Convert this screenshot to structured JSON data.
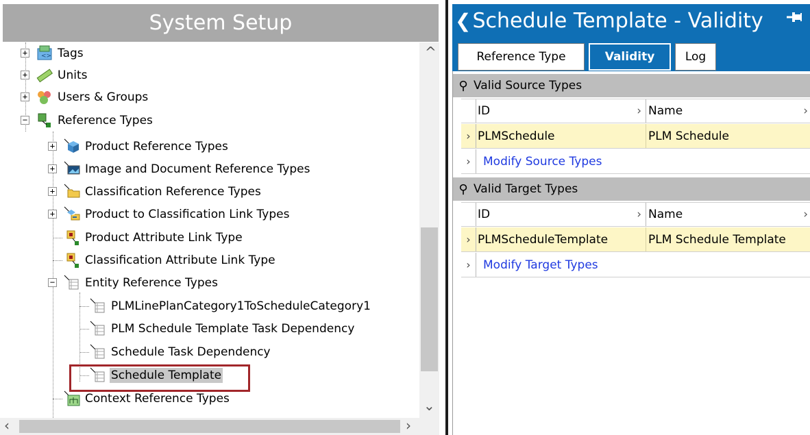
{
  "left_panel": {
    "title": "System Setup",
    "tree": [
      {
        "label": "Tags",
        "icon": "tags-icon"
      },
      {
        "label": "Units",
        "icon": "ruler-icon"
      },
      {
        "label": "Users & Groups",
        "icon": "users-groups-icon"
      },
      {
        "label": "Reference Types",
        "icon": "reference-types-icon"
      },
      {
        "label": "Product Reference Types",
        "icon": "product-ref-icon"
      },
      {
        "label": "Image and Document Reference Types",
        "icon": "image-doc-ref-icon"
      },
      {
        "label": "Classification Reference Types",
        "icon": "folder-icon"
      },
      {
        "label": "Product to Classification Link Types",
        "icon": "product-class-link-icon"
      },
      {
        "label": "Product Attribute Link Type",
        "icon": "attribute-link-icon"
      },
      {
        "label": "Classification Attribute Link Type",
        "icon": "attribute-link-icon"
      },
      {
        "label": "Entity Reference Types",
        "icon": "entity-ref-icon"
      },
      {
        "label": "PLMLinePlanCategory1ToScheduleCategory1",
        "icon": "entity-icon"
      },
      {
        "label": "PLM Schedule Template Task Dependency",
        "icon": "entity-icon"
      },
      {
        "label": "Schedule Task Dependency",
        "icon": "entity-icon"
      },
      {
        "label": "Schedule Template",
        "icon": "entity-icon"
      },
      {
        "label": "Context Reference Types",
        "icon": "context-ref-icon"
      }
    ]
  },
  "right_panel": {
    "title": "Schedule Template - Validity",
    "tabs": [
      {
        "label": "Reference Type",
        "active": false
      },
      {
        "label": "Validity",
        "active": true
      },
      {
        "label": "Log",
        "active": false
      }
    ],
    "source_section": {
      "title": "Valid Source Types",
      "col_id": "ID",
      "col_name": "Name",
      "row_id": "PLMSchedule",
      "row_name": "PLM Schedule",
      "link": "Modify Source Types"
    },
    "target_section": {
      "title": "Valid Target Types",
      "col_id": "ID",
      "col_name": "Name",
      "row_id": "PLMScheduleTemplate",
      "row_name": "PLM Schedule Template",
      "link": "Modify Target Types"
    }
  },
  "colors": {
    "header_blue": "#0f6fb5",
    "row_highlight": "#fdf6c6",
    "selection_border": "#a1262a",
    "link": "#1f3ae0"
  }
}
